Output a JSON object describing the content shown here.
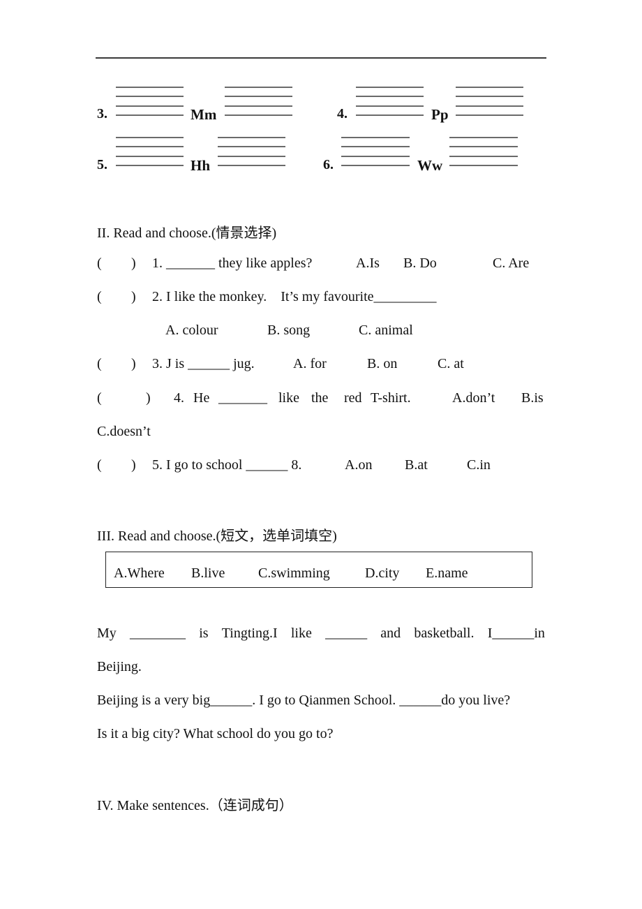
{
  "section1": {
    "items": [
      {
        "number": "3.",
        "letters": "Mm"
      },
      {
        "number": "4.",
        "letters": "Pp"
      },
      {
        "number": "5.",
        "letters": "Hh"
      },
      {
        "number": "6.",
        "letters": "Ww"
      }
    ]
  },
  "section2": {
    "heading": "II. Read and choose.(情景选择)",
    "questions": [
      {
        "paren_open": "(",
        "paren_close": ")",
        "stem": "1. _______ they like apples?",
        "options": [
          "A.Is",
          "B. Do",
          "C. Are"
        ]
      },
      {
        "paren_open": "(",
        "paren_close": ")",
        "stem": "2. I like the monkey.    It’s my favourite_________",
        "options": [
          "A. colour",
          "B. song",
          "C. animal"
        ]
      },
      {
        "paren_open": "(",
        "paren_close": ")",
        "stem": "3. J is ______ jug.",
        "options": [
          "A. for",
          "B. on",
          "C. at"
        ]
      },
      {
        "paren_open": "(",
        "paren_close": ")",
        "stem_words": [
          "4.",
          "He",
          "_______",
          "like",
          "the",
          "red",
          "T-shirt."
        ],
        "options": [
          "A.don’t",
          "B.is",
          "C.doesn’t"
        ]
      },
      {
        "paren_open": "(",
        "paren_close": ")",
        "stem": "5. I go to school ______ 8.",
        "options": [
          "A.on",
          "B.at",
          "C.in"
        ]
      }
    ]
  },
  "section3": {
    "heading": "III. Read and choose.(短文，选单词填空)",
    "word_bank": [
      "A.Where",
      "B.live",
      "C.swimming",
      "D.city",
      "E.name"
    ],
    "passage_line1_words": [
      "My",
      "________",
      "is",
      "Tingting.I",
      "like",
      "______",
      "and",
      "basketball.",
      "I______in"
    ],
    "passage_line2": "Beijing.",
    "passage_line3": "Beijing is a very big______. I go to Qianmen School. ______do you live?",
    "passage_line4": "Is it a big city? What school do you go to?"
  },
  "section4": {
    "heading": "IV. Make sentences.（连词成句）"
  }
}
